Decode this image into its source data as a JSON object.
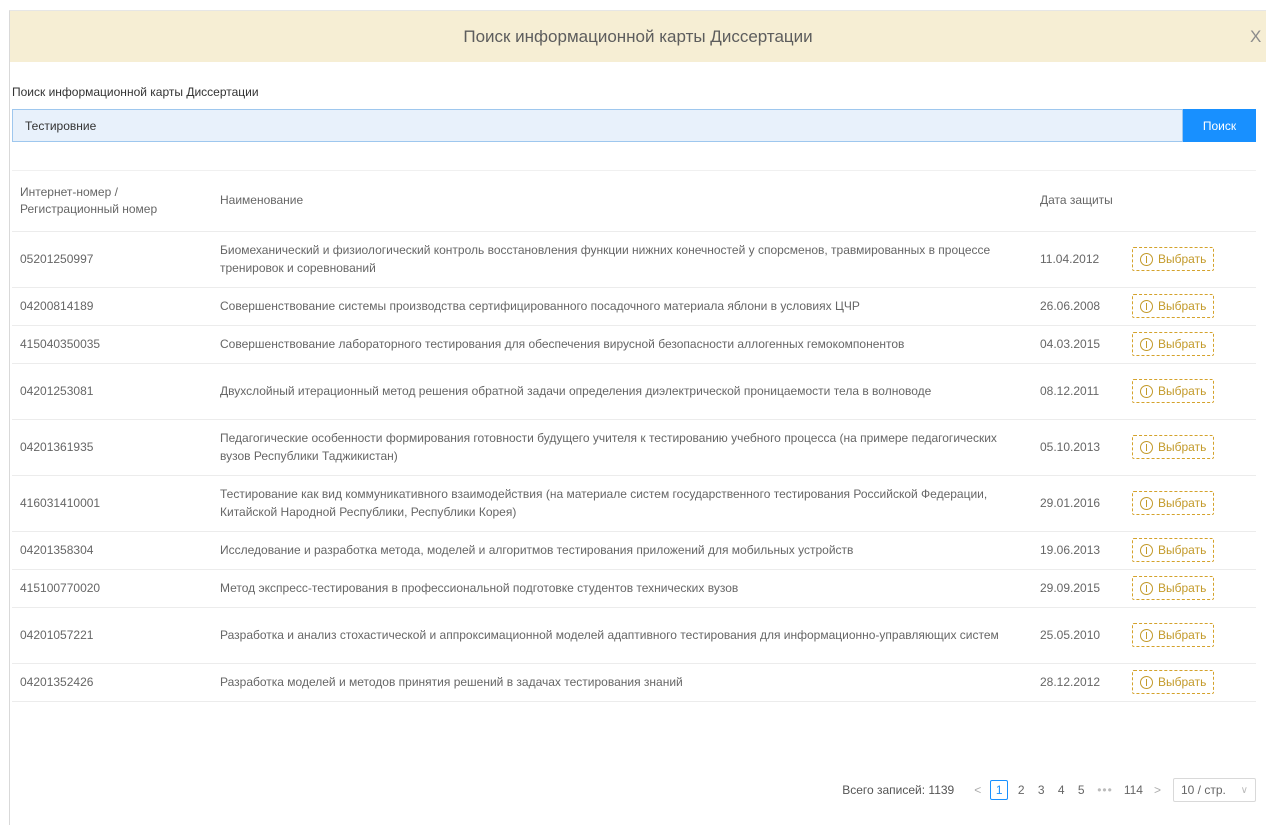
{
  "dialog": {
    "title": "Поиск информационной карты Диссертации",
    "close_label": "X"
  },
  "search": {
    "label": "Поиск информационной карты Диссертации",
    "value": "Тестировние",
    "button_label": "Поиск"
  },
  "table": {
    "headers": {
      "number": "Интернет-номер / Регистрационный номер",
      "name": "Наименование",
      "date": "Дата защиты"
    },
    "action_label": "Выбрать",
    "rows": [
      {
        "number": "05201250997",
        "name": "Биомеханический и физиологический контроль восстановления функции нижних конечностей у спорсменов, травмированных в процессе тренировок и соревнований",
        "date": "11.04.2012"
      },
      {
        "number": "04200814189",
        "name": "Совершенствование системы производства сертифицированного посадочного материала яблони в условиях ЦЧР",
        "date": "26.06.2008"
      },
      {
        "number": "415040350035",
        "name": "Совершенствование лабораторного тестирования для обеспечения вирусной безопасности аллогенных гемокомпонентов",
        "date": "04.03.2015"
      },
      {
        "number": "04201253081",
        "name": "Двухслойный итерационный метод решения обратной задачи определения диэлектрической проницаемости тела в волноводе",
        "date": "08.12.2011"
      },
      {
        "number": "04201361935",
        "name": "Педагогические особенности формирования готовности будущего учителя к тестированию учебного процесса (на примере педагогических вузов Республики Таджикистан)",
        "date": "05.10.2013"
      },
      {
        "number": "416031410001",
        "name": "Тестирование как вид коммуникативного взаимодействия (на материале систем государственного тестирования Российской Федерации, Китайской Народной Республики, Республики Корея)",
        "date": "29.01.2016"
      },
      {
        "number": "04201358304",
        "name": "Исследование и разработка метода, моделей и алгоритмов тестирования приложений для мобильных устройств",
        "date": "19.06.2013"
      },
      {
        "number": "415100770020",
        "name": "Метод экспресс-тестирования в профессиональной подготовке студентов технических вузов",
        "date": "29.09.2015"
      },
      {
        "number": "04201057221",
        "name": "Разработка и анализ стохастической и аппроксимационной моделей адаптивного тестирования для информационно-управляющих систем",
        "date": "25.05.2010"
      },
      {
        "number": "04201352426",
        "name": "Разработка моделей и методов принятия решений в задачах тестирования знаний",
        "date": "28.12.2012"
      }
    ]
  },
  "pagination": {
    "total": "Всего записей: 1139",
    "prev": "<",
    "next": ">",
    "pages": [
      "1",
      "2",
      "3",
      "4",
      "5"
    ],
    "active_page": "1",
    "dots": "•••",
    "last_page": "114",
    "page_size": "10 / стр."
  },
  "colors": {
    "header_bg": "#f6eed4",
    "accent": "#1890ff",
    "select_button": "#c39a2a"
  }
}
